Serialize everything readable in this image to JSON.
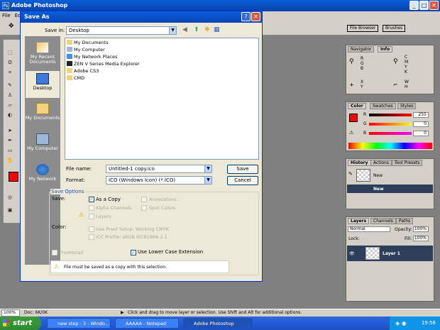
{
  "app": {
    "title": "Adobe Photoshop",
    "logo": "Ps"
  },
  "menubar": {
    "items": [
      "File",
      "Edit"
    ]
  },
  "options_bar": {
    "tabs": [
      "File Browser",
      "Brushes"
    ]
  },
  "navigator_panel": {
    "tabs": [
      "Navigator",
      "Info"
    ],
    "rgb_labels": [
      "R",
      "G",
      "B"
    ],
    "cmyk_labels": [
      "C",
      "M",
      "Y",
      "K"
    ],
    "xy_labels": [
      "X",
      "Y"
    ],
    "wh_labels": [
      "W",
      "H"
    ]
  },
  "color_panel": {
    "tabs": [
      "Color",
      "Swatches",
      "Styles"
    ],
    "channels": [
      {
        "label": "R",
        "value": "255"
      },
      {
        "label": "G",
        "value": "0"
      },
      {
        "label": "B",
        "value": "0"
      }
    ]
  },
  "history_panel": {
    "tabs": [
      "History",
      "Actions",
      "Tool Presets"
    ],
    "items": [
      "New",
      "New"
    ]
  },
  "layers_panel": {
    "tabs": [
      "Layers",
      "Channels",
      "Paths"
    ],
    "blend_mode": "Normal",
    "opacity_label": "Opacity:",
    "opacity": "100%",
    "lock_label": "Lock:",
    "fill_label": "Fill:",
    "fill": "100%",
    "layer_name": "Layer 1"
  },
  "dialog": {
    "title": "Save As",
    "save_in_label": "Save in:",
    "save_in_value": "Desktop",
    "places": [
      "My Recent Documents",
      "Desktop",
      "My Documents",
      "My Computer",
      "My Network"
    ],
    "files": [
      "My Documents",
      "My Computer",
      "My Network Places",
      "ZEN V Series Media Explorer",
      "Adobe CS3",
      "CMD"
    ],
    "file_name_label": "File name:",
    "file_name_value": "Untitled-1 copy.ico",
    "format_label": "Format:",
    "format_value": "ICO (Windows Icon) (*.ICO)",
    "save_button": "Save",
    "cancel_button": "Cancel",
    "save_options_legend": "Save Options",
    "save_label": "Save:",
    "as_a_copy": "As a Copy",
    "annotations": "Annotations",
    "alpha_channels": "Alpha Channels",
    "spot_colors": "Spot Colors",
    "layers": "Layers",
    "color_label": "Color:",
    "use_proof_setup": "Use Proof Setup:  Working CMYK",
    "icc_profile": "ICC Profile:  sRGB IEC61966-2.1",
    "thumbnail": "Thumbnail",
    "use_lower_case": "Use Lower Case Extension",
    "warning": "File must be saved as a copy with this selection."
  },
  "status_bar": {
    "zoom": "100%",
    "doc": "Doc: 6K/0K",
    "hint": "Click and drag to move layer or selection. Use Shift and Alt for additional options."
  },
  "taskbar": {
    "start": "start",
    "tasks": [
      "new step : 3 - Windo...",
      "AAAAA - Notepad",
      "Adobe Photoshop"
    ],
    "clock": "19:56"
  },
  "colors": {
    "xp_blue": "#0a5fd8",
    "foreground": "#ff0000",
    "start_green": "#3c9a3c"
  }
}
